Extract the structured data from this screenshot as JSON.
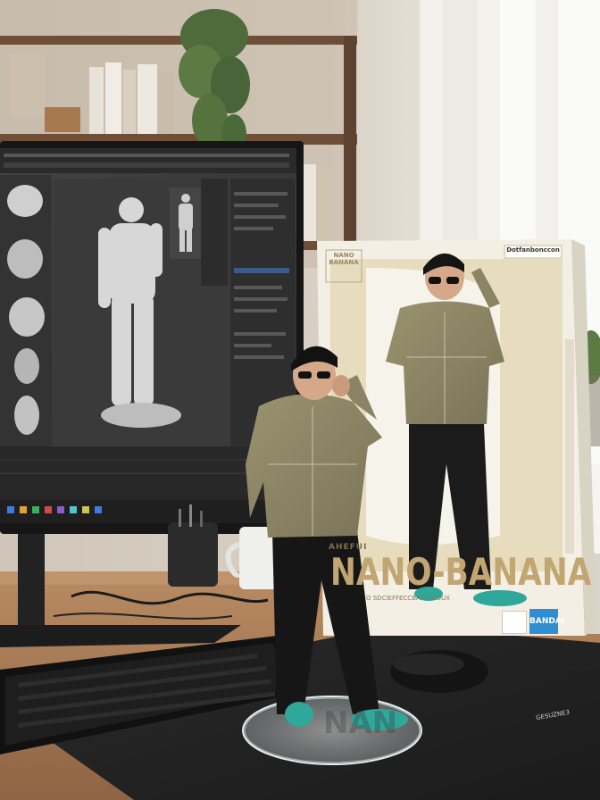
{
  "scene": {
    "description_free": true
  },
  "box": {
    "logo_text": "NANO BANANA",
    "corner_label": "Dotfanbonccon",
    "side_text": "AHEFUI",
    "title": "NANO-BANANA",
    "subtitle": "O SDCIEFFECCBAISIECOUX",
    "brand": "BANDAI"
  },
  "mat": {
    "brand": "GESUZNE3"
  },
  "base": {
    "text": "NAN"
  },
  "colors": {
    "sweater": "#8c8565",
    "pants": "#1b1b1b",
    "sandals": "#2fa79a",
    "box_bg": "#f3efe4",
    "box_cream": "#e7dcbd",
    "desk": "#a67952",
    "monitor": "#1a1a1a",
    "app_bg": "#3b3b3b"
  },
  "icons": [
    "monitor-icon",
    "keyboard-icon",
    "mouse-icon",
    "mug-icon",
    "plant-icon",
    "pen-cup-icon"
  ]
}
